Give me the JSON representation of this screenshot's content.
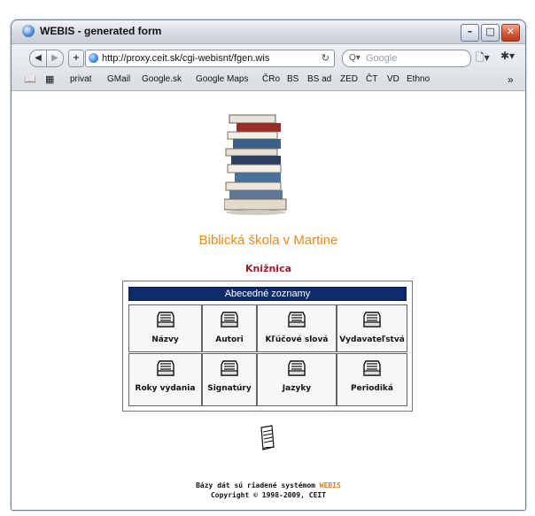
{
  "window": {
    "title": "WEBIS - generated form",
    "minimize": "–",
    "maximize": "□",
    "close": "✕"
  },
  "toolbar": {
    "back": "◀",
    "forward": "▶",
    "add": "+",
    "url": "http://proxy.ceit.sk/cgi-webisnt/fgen.wis",
    "reload": "↻",
    "search_placeholder": "Google",
    "search_icon": "Q▾",
    "page_menu": "🗋▾",
    "settings_menu": "✱▾"
  },
  "bookmarks": {
    "book_icon": "📖",
    "grid_icon": "▦",
    "items": [
      "privat",
      "GMail",
      "Google.sk",
      "Google Maps",
      "ČRo",
      "BS",
      "BS ad",
      "ZED",
      "ČT",
      "VD",
      "Ethno"
    ],
    "more": "»"
  },
  "page": {
    "school_name": "Biblická škola v Martine",
    "library": "Knižnica",
    "section_header": "Abecedné zoznamy",
    "cells": [
      {
        "label": "Názvy",
        "icon": "card-file-icon"
      },
      {
        "label": "Autori",
        "icon": "card-file-icon"
      },
      {
        "label": "Kľúčové slová",
        "icon": "card-file-icon"
      },
      {
        "label": "Vydavateľstvá",
        "icon": "card-file-icon"
      },
      {
        "label": "Roky vydania",
        "icon": "card-file-icon"
      },
      {
        "label": "Signatúry",
        "icon": "card-file-icon"
      },
      {
        "label": "Jazyky",
        "icon": "card-file-icon"
      },
      {
        "label": "Periodiká",
        "icon": "card-file-icon"
      }
    ],
    "footer_prefix": "Bázy dát sú riadené systémom",
    "footer_brand": "WEBIS",
    "copyright": "Copyright © 1998-2009, CEIT"
  },
  "colors": {
    "accent": "#ee8a18",
    "header_bg": "#0e2c6c",
    "library": "#a2182b"
  }
}
